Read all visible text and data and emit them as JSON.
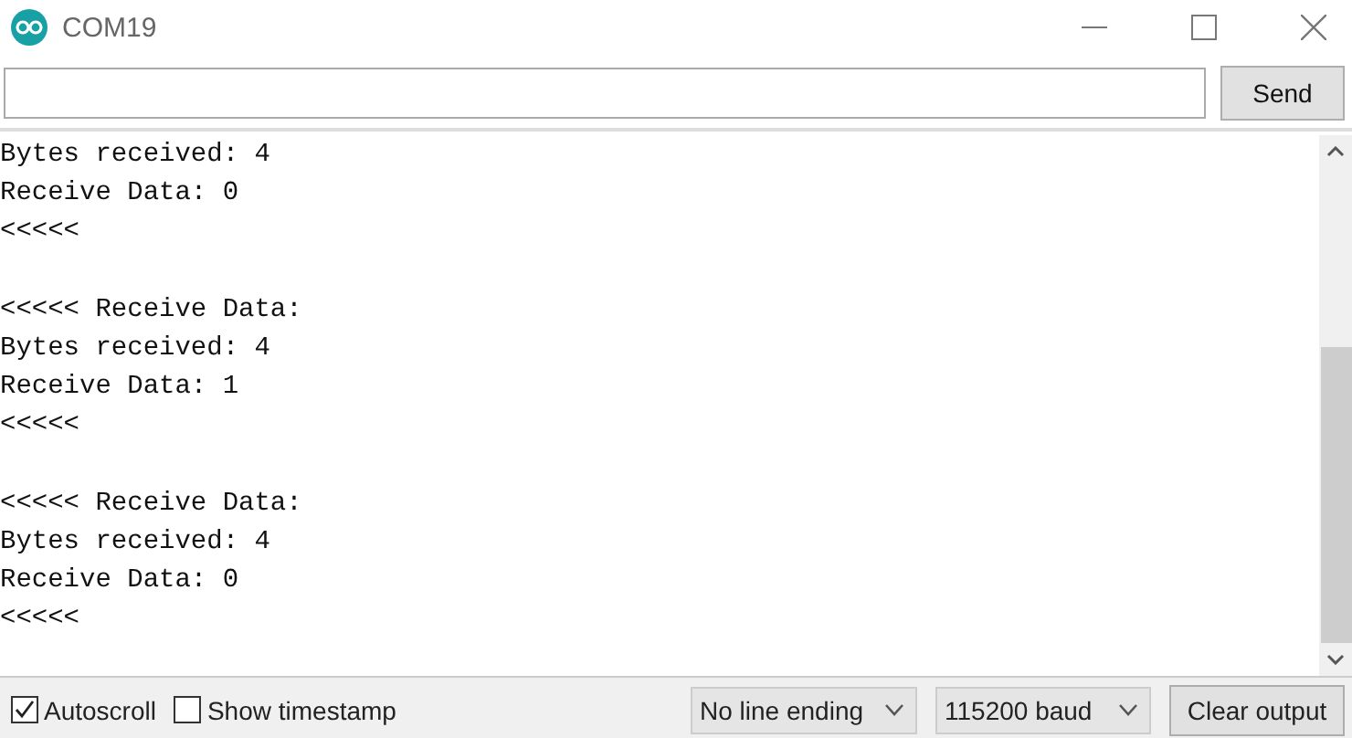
{
  "window": {
    "title": "COM19"
  },
  "send_bar": {
    "button": "Send"
  },
  "output": {
    "blocks": [
      [
        "Bytes received: 4",
        "Receive Data: 0",
        "<<<<<"
      ],
      [
        "<<<<< Receive Data:",
        "Bytes received: 4",
        "Receive Data: 1",
        "<<<<<"
      ],
      [
        "<<<<< Receive Data:",
        "Bytes received: 4",
        "Receive Data: 0",
        "<<<<<"
      ]
    ]
  },
  "status_bar": {
    "checkboxes": [
      {
        "label": "Autoscroll",
        "checked": true
      },
      {
        "label": "Show timestamp",
        "checked": false
      }
    ],
    "dropdowns": [
      {
        "value": "No line ending"
      },
      {
        "value": "115200 baud"
      }
    ],
    "button": "Clear output"
  }
}
